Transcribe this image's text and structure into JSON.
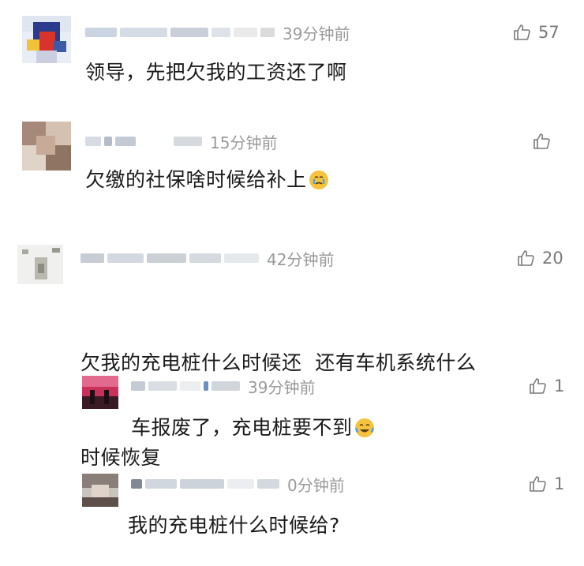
{
  "comments": [
    {
      "time": "39分钟前",
      "text": "领导，先把欠我的工资还了啊",
      "likes": "57",
      "emoji": null
    },
    {
      "time": "15分钟前",
      "text": "欠缴的社保啥时候给补上",
      "likes": "",
      "emoji": "crying-face-emoji"
    },
    {
      "time": "42分钟前",
      "text_line1": "欠我的充电桩什么时候还  还有车机系统什么",
      "text_line2": "时候恢复",
      "likes": "20",
      "emoji": null,
      "replies": [
        {
          "time": "39分钟前",
          "text": "车报废了，充电桩要不到",
          "likes": "1",
          "emoji": "tears-of-joy-emoji"
        },
        {
          "time": "0分钟前",
          "text": "我的充电桩什么时候给?",
          "likes": "1",
          "emoji": null
        }
      ]
    }
  ],
  "colors": {
    "time": "#9a9a9a",
    "text": "#1a1a1a",
    "like": "#7a7a7a"
  }
}
